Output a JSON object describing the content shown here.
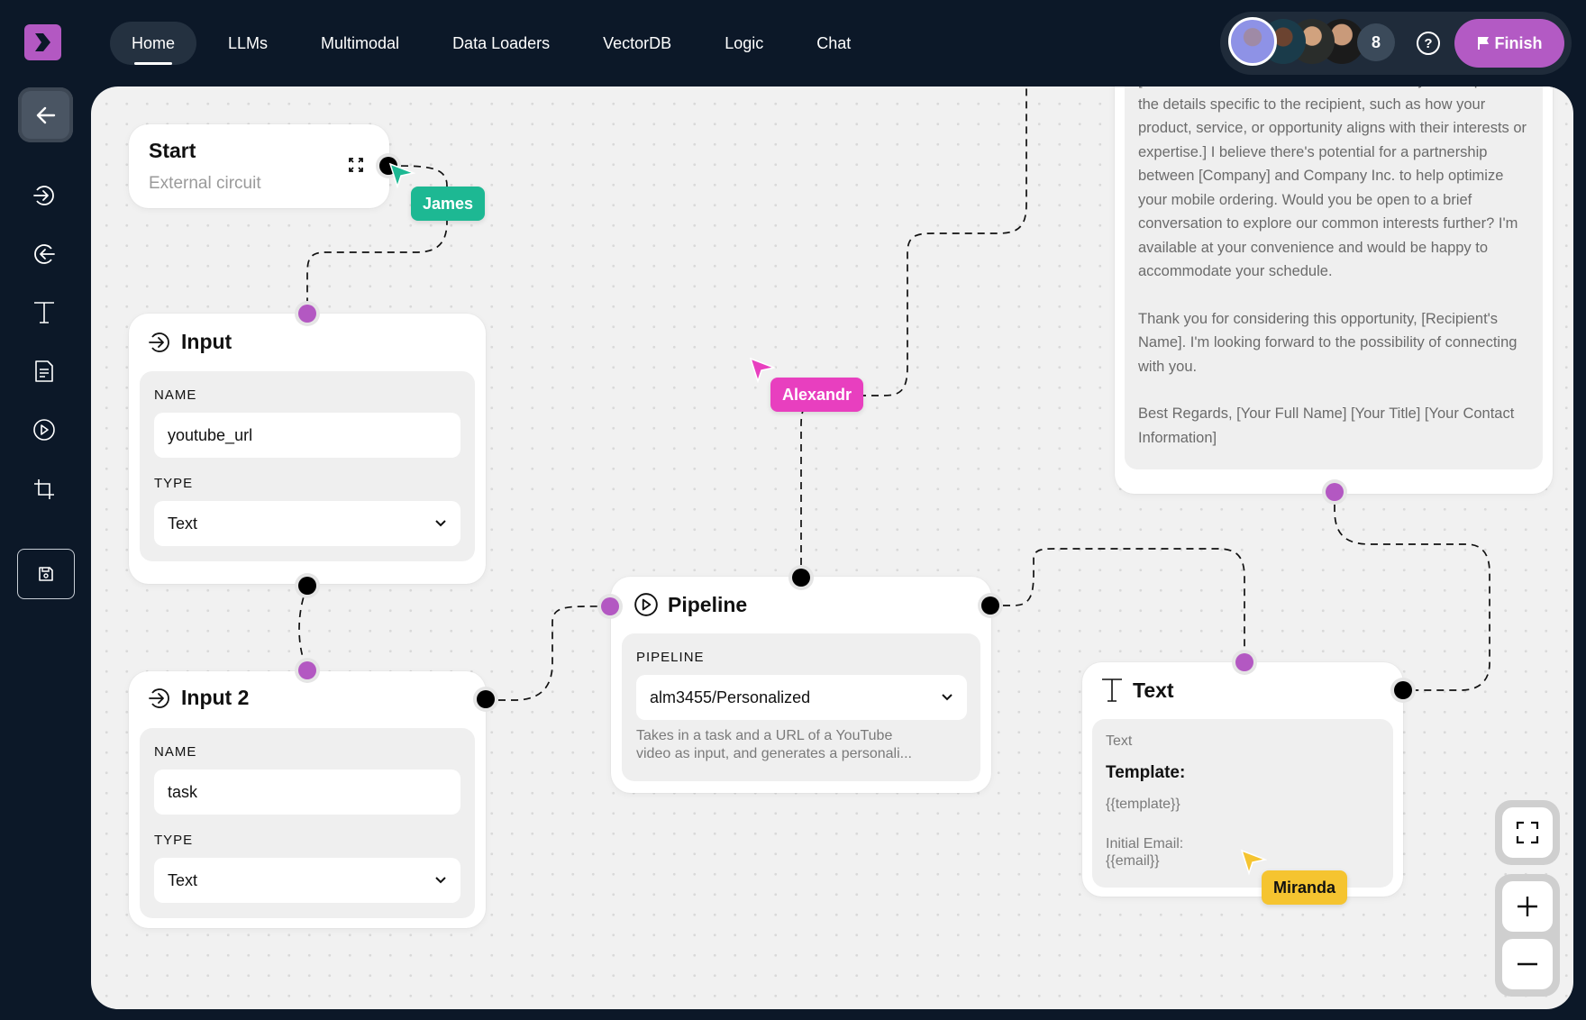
{
  "header": {
    "logo": "chevron-right-logo",
    "nav": [
      {
        "label": "Home",
        "active": true
      },
      {
        "label": "LLMs",
        "active": false
      },
      {
        "label": "Multimodal",
        "active": false
      },
      {
        "label": "Data Loaders",
        "active": false
      },
      {
        "label": "VectorDB",
        "active": false
      },
      {
        "label": "Logic",
        "active": false
      },
      {
        "label": "Chat",
        "active": false
      }
    ],
    "collaborators_extra_count": "8",
    "help_label": "?",
    "finish_label": "Finish"
  },
  "sidebar": {
    "items": [
      {
        "icon": "arrow-left-icon",
        "label": "Back"
      },
      {
        "icon": "input-icon",
        "label": "Input"
      },
      {
        "icon": "output-icon",
        "label": "Output"
      },
      {
        "icon": "text-icon",
        "label": "Text"
      },
      {
        "icon": "document-icon",
        "label": "Document"
      },
      {
        "icon": "pipeline-icon",
        "label": "Pipeline"
      },
      {
        "icon": "crop-icon",
        "label": "Crop"
      },
      {
        "icon": "save-icon",
        "label": "Save"
      }
    ]
  },
  "nodes": {
    "start": {
      "title": "Start",
      "subtitle": "External circuit"
    },
    "input1": {
      "title": "Input",
      "name_label": "NAME",
      "name_value": "youtube_url",
      "type_label": "TYPE",
      "type_value": "Text"
    },
    "input2": {
      "title": "Input 2",
      "name_label": "NAME",
      "name_value": "task",
      "type_label": "TYPE",
      "type_value": "Text"
    },
    "pipeline": {
      "title": "Pipeline",
      "field_label": "PIPELINE",
      "value": "alm3455/Personalized",
      "description": "Takes in a task and a URL of a YouTube video as input, and generates a personali..."
    },
    "email": {
      "paragraphs": [
        "[Insert custom content here. Here's where you can put in the details specific to the recipient, such as how your product, service, or opportunity aligns with their interests or expertise.] I believe there's potential for a partnership between [Company] and Company Inc. to help optimize your mobile ordering. Would you be open to a brief conversation to explore our common interests further? I'm available at your convenience and would be happy to accommodate your schedule.",
        "Thank you for considering this opportunity, [Recipient's Name]. I'm looking forward to the possibility of connecting with you.",
        "Best Regards, [Your Full Name] [Your Title] [Your Contact Information]"
      ]
    },
    "text": {
      "title": "Text",
      "label": "Text",
      "template_heading": "Template:",
      "template_var": "{{template}}",
      "email_label": "Initial Email:",
      "email_var": "{{email}}"
    }
  },
  "cursors": [
    {
      "name": "James",
      "color": "#1db893"
    },
    {
      "name": "Alexandr",
      "color": "#e83fbf"
    },
    {
      "name": "Miranda",
      "color": "#f5c430"
    }
  ],
  "colors": {
    "accent": "#b358c2",
    "background": "#0c1828",
    "canvas": "#f1f1f1"
  }
}
